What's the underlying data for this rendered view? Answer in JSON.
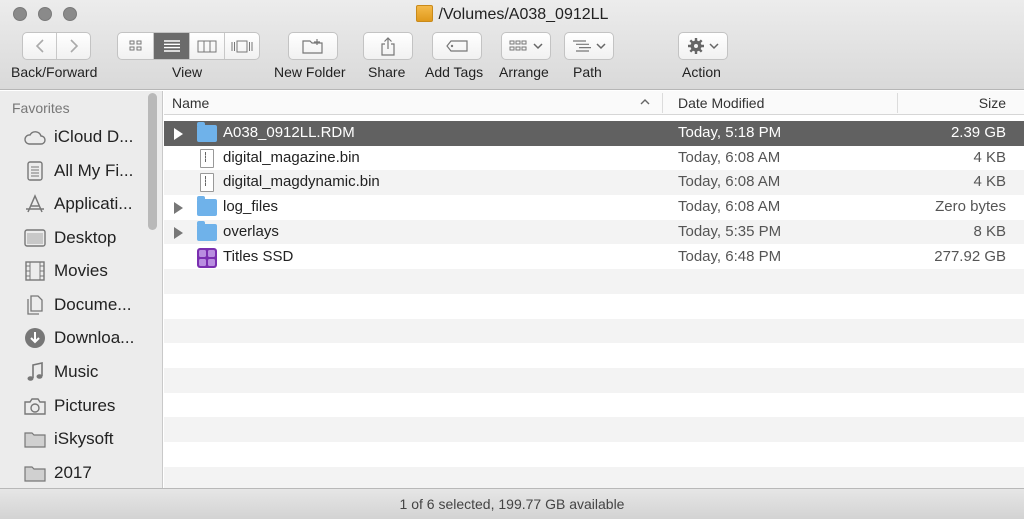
{
  "window": {
    "title": "/Volumes/A038_0912LL",
    "title_icon": "external-drive-icon"
  },
  "toolbar": {
    "back_forward_label": "Back/Forward",
    "view_label": "View",
    "new_folder_label": "New Folder",
    "share_label": "Share",
    "add_tags_label": "Add Tags",
    "arrange_label": "Arrange",
    "path_label": "Path",
    "action_label": "Action",
    "active_view": "list"
  },
  "sidebar": {
    "heading": "Favorites",
    "items": [
      {
        "label": "iCloud D...",
        "icon": "cloud-icon"
      },
      {
        "label": "All My Fi...",
        "icon": "all-files-icon"
      },
      {
        "label": "Applicati...",
        "icon": "applications-icon"
      },
      {
        "label": "Desktop",
        "icon": "desktop-icon"
      },
      {
        "label": "Movies",
        "icon": "film-icon"
      },
      {
        "label": "Docume...",
        "icon": "documents-icon"
      },
      {
        "label": "Downloa...",
        "icon": "download-icon"
      },
      {
        "label": "Music",
        "icon": "music-note-icon"
      },
      {
        "label": "Pictures",
        "icon": "camera-icon"
      },
      {
        "label": "iSkysoft",
        "icon": "folder-icon"
      },
      {
        "label": "2017",
        "icon": "folder-icon"
      }
    ]
  },
  "list": {
    "columns": {
      "name": "Name",
      "date": "Date Modified",
      "size": "Size"
    },
    "rows": [
      {
        "name": "A038_0912LL.RDM",
        "date": "Today, 5:18 PM",
        "size": "2.39 GB",
        "kind": "folder",
        "expandable": true,
        "selected": true
      },
      {
        "name": "digital_magazine.bin",
        "date": "Today, 6:08 AM",
        "size": "4 KB",
        "kind": "document",
        "expandable": false,
        "selected": false
      },
      {
        "name": "digital_magdynamic.bin",
        "date": "Today, 6:08 AM",
        "size": "4 KB",
        "kind": "document",
        "expandable": false,
        "selected": false
      },
      {
        "name": "log_files",
        "date": "Today, 6:08 AM",
        "size": "Zero bytes",
        "kind": "folder",
        "expandable": true,
        "selected": false
      },
      {
        "name": "overlays",
        "date": "Today, 5:35 PM",
        "size": "8 KB",
        "kind": "folder",
        "expandable": true,
        "selected": false
      },
      {
        "name": "Titles SSD",
        "date": "Today, 6:48 PM",
        "size": "277.92 GB",
        "kind": "app",
        "expandable": false,
        "selected": false
      }
    ]
  },
  "status": {
    "text": "1 of 6 selected, 199.77 GB available"
  },
  "colors": {
    "selection": "#616161",
    "folder": "#6fb2ea",
    "drive": "#e8a52c",
    "app": "#7a2fb0"
  }
}
